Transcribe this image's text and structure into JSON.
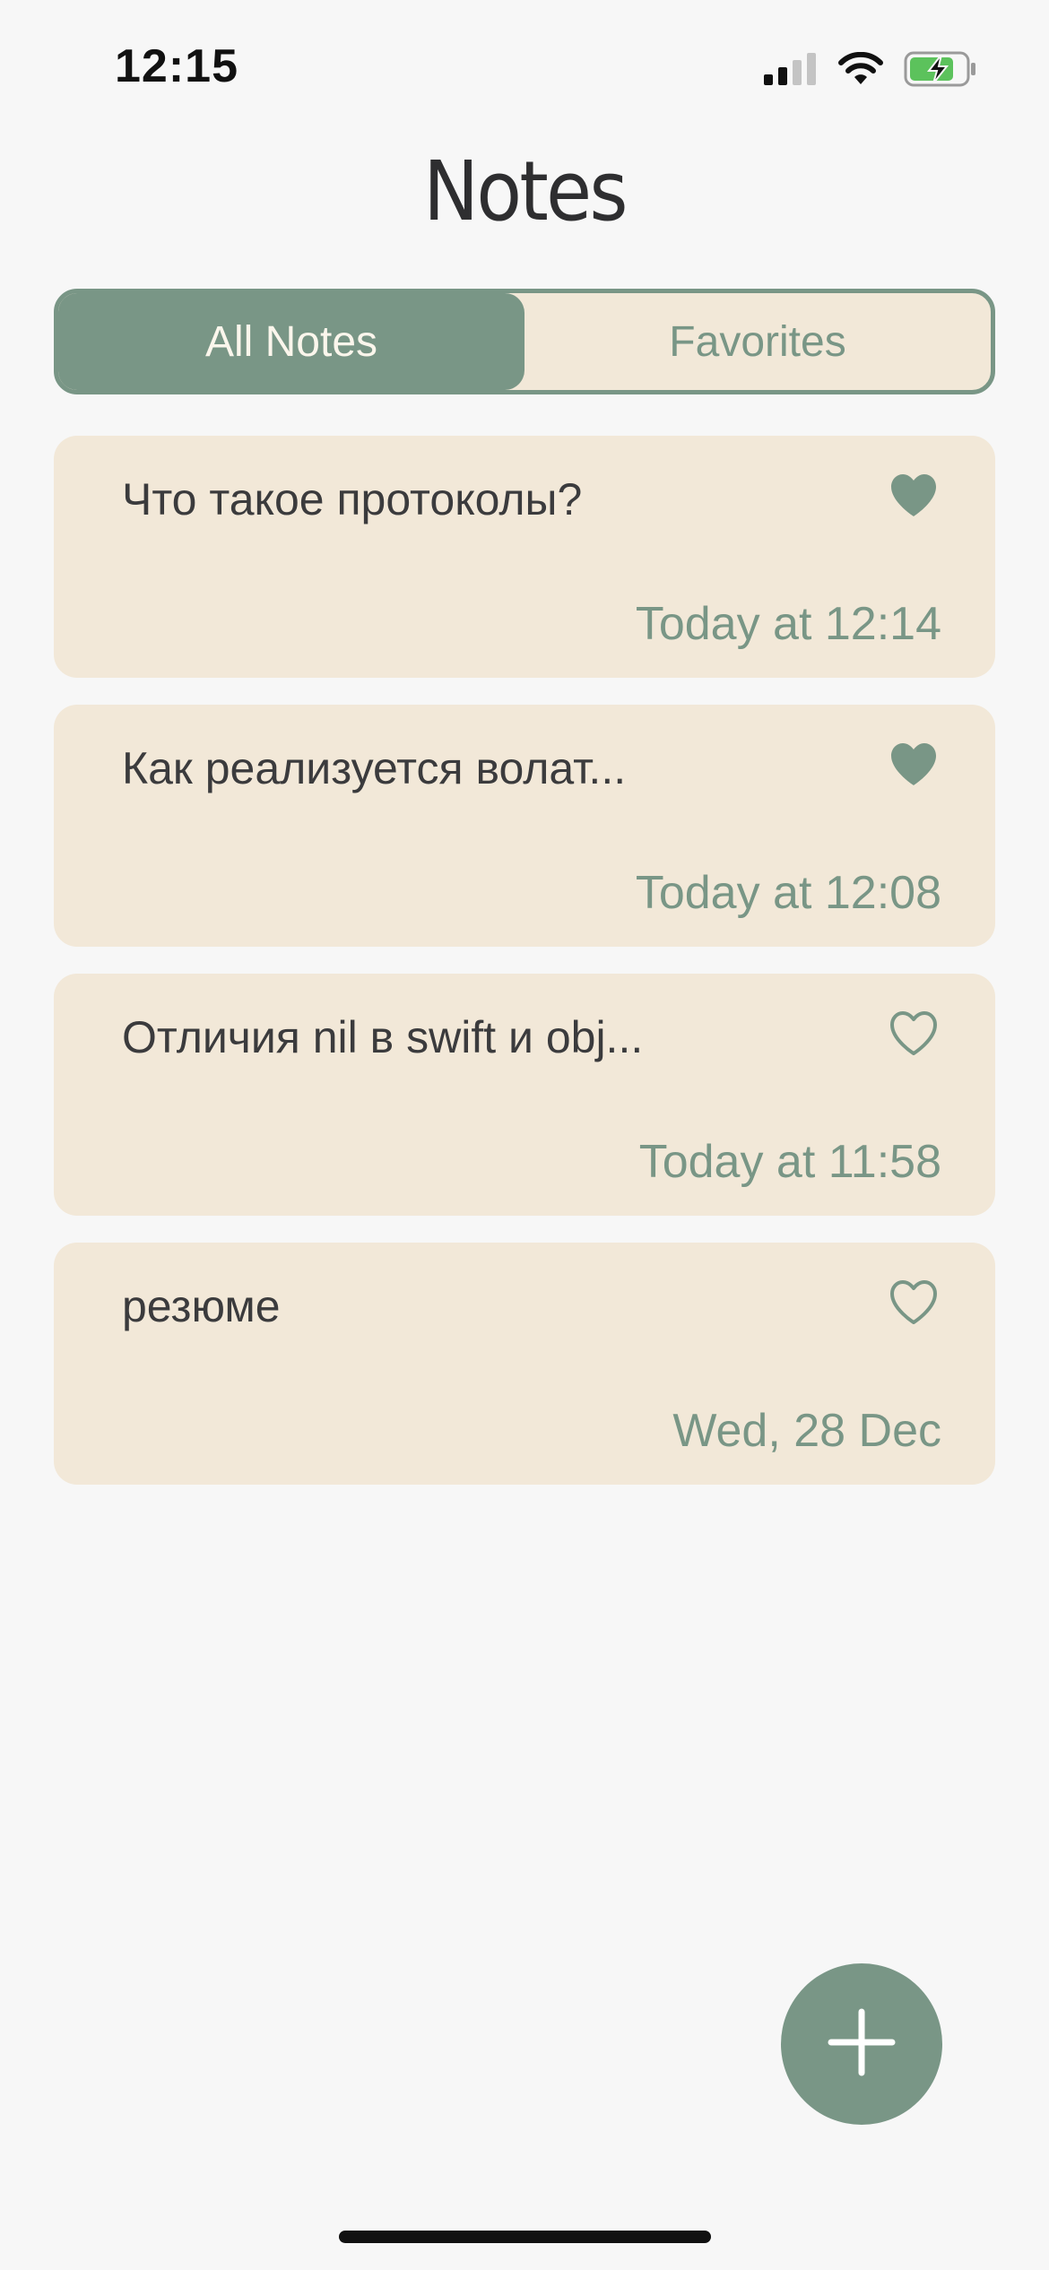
{
  "status_bar": {
    "time": "12:15",
    "icons": [
      "cellular-signal-icon",
      "wifi-icon",
      "battery-charging-icon"
    ]
  },
  "header": {
    "title": "Notes"
  },
  "tabs": [
    {
      "label": "All Notes",
      "selected": true
    },
    {
      "label": "Favorites",
      "selected": false
    }
  ],
  "notes": [
    {
      "title": "Что такое протоколы?",
      "date": "Today at 12:14",
      "favorite": true
    },
    {
      "title": "Как реализуется волат...",
      "date": "Today at 12:08",
      "favorite": true
    },
    {
      "title": "Отличия nil в swift и obj...",
      "date": "Today at 11:58",
      "favorite": false
    },
    {
      "title": "резюме",
      "date": "Wed, 28 Dec",
      "favorite": false
    }
  ],
  "actions": {
    "add_icon": "plus-icon"
  },
  "colors": {
    "accent": "#799686",
    "card_background": "#f2e8d8",
    "page_background": "#f7f7f7",
    "text": "#3b3b3d"
  }
}
